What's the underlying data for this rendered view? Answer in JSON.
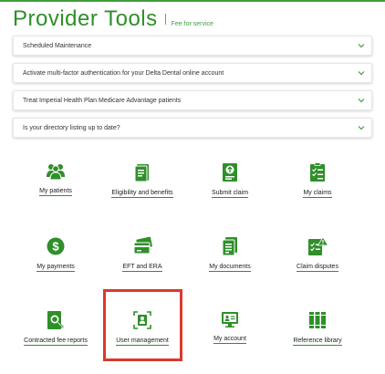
{
  "header": {
    "title": "Provider Tools",
    "subtitle": "Fee for service"
  },
  "accordions": [
    {
      "label": "Scheduled Maintenance"
    },
    {
      "label": "Activate multi-factor authentication for your Delta Dental online account"
    },
    {
      "label": "Treat Imperial Health Plan Medicare Advantage patients"
    },
    {
      "label": "Is your directory listing up to date?"
    }
  ],
  "tiles": [
    {
      "label": "My patients",
      "icon": "patients-icon"
    },
    {
      "label": "Eligibility and benefits",
      "icon": "eligibility-icon"
    },
    {
      "label": "Submit claim",
      "icon": "submit-claim-icon"
    },
    {
      "label": "My claims",
      "icon": "claims-checklist-icon"
    },
    {
      "label": "My payments",
      "icon": "dollar-icon"
    },
    {
      "label": "EFT and ERA",
      "icon": "cards-icon"
    },
    {
      "label": "My documents",
      "icon": "documents-icon"
    },
    {
      "label": "Claim disputes",
      "icon": "claim-disputes-icon"
    },
    {
      "label": "Contracted fee reports",
      "icon": "fee-report-icon"
    },
    {
      "label": "User management",
      "icon": "user-management-icon"
    },
    {
      "label": "My account",
      "icon": "account-icon"
    },
    {
      "label": "Reference library",
      "icon": "library-icon"
    }
  ],
  "colors": {
    "brand_green": "#2f8f2a",
    "highlight_red": "#d93a2b"
  }
}
